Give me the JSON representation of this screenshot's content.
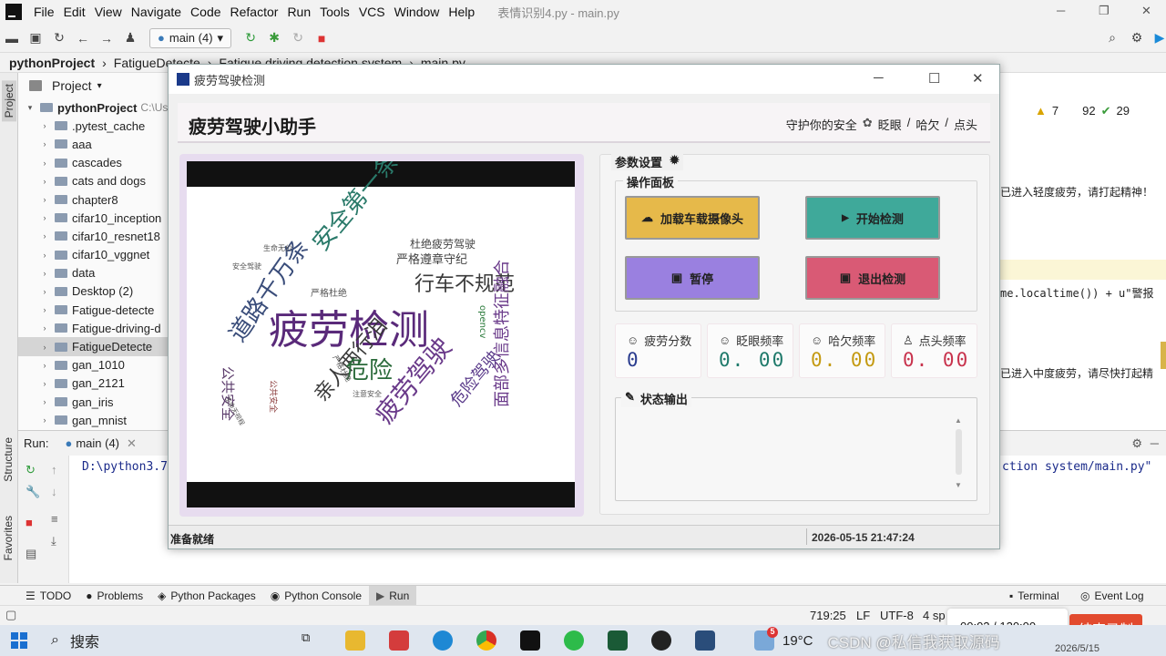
{
  "ide": {
    "menu": [
      "File",
      "Edit",
      "View",
      "Navigate",
      "Code",
      "Refactor",
      "Run",
      "Tools",
      "VCS",
      "Window",
      "Help"
    ],
    "window_title": "表情识别4.py - main.py",
    "run_config": "main (4)",
    "breadcrumb": [
      "pythonProject",
      "FatigueDetecte",
      "Fatigue driving detection system",
      "main.py"
    ],
    "project_panel": {
      "title": "Project",
      "root": "pythonProject",
      "root_path": "C:\\Us",
      "items": [
        ".pytest_cache",
        "aaa",
        "cascades",
        "cats and dogs",
        "chapter8",
        "cifar10_inception",
        "cifar10_resnet18",
        "cifar10_vggnet",
        "data",
        "Desktop (2)",
        "Fatigue-detecte",
        "Fatigue-driving-d",
        "FatigueDetecte",
        "gan_1010",
        "gan_2121",
        "gan_iris",
        "gan_mnist"
      ],
      "selected": "FatigueDetecte"
    },
    "inspections": {
      "warnings": "7",
      "weak": "92",
      "ok": "29"
    },
    "editor_lines": [
      "已进入轻度疲劳，请打起精神！",
      "me.localtime()) + u\"警报",
      "已进入中度疲劳，请尽快打起精"
    ],
    "run_tab": {
      "label": "Run:",
      "config": "main (4)",
      "line_left": "D:\\python3.7",
      "line_right": "ction system/main.py\""
    },
    "side_tabs": {
      "project": "Project",
      "structure": "Structure",
      "favorites": "Favorites"
    },
    "bottom_tabs": [
      "TODO",
      "Problems",
      "Python Packages",
      "Python Console",
      "Run",
      "Terminal",
      "Event Log"
    ],
    "status": {
      "position": "719:25",
      "line_sep": "LF",
      "encoding": "UTF-8",
      "indent": "4 sp"
    },
    "recorder": {
      "time": "00:02 / 120:00",
      "button": "结束录制"
    }
  },
  "taskbar": {
    "search_label": "搜索",
    "weather": "19°C",
    "weather_badge": "5",
    "watermark": "CSDN @私信我获取源码",
    "date": "2026/5/15"
  },
  "app": {
    "window_title": "疲劳驾驶检测",
    "heading": "疲劳驾驶小助手",
    "slogan": {
      "lead": "守护你的安全",
      "items": [
        "眨眼",
        "哈欠",
        "点头"
      ],
      "sep": "/"
    },
    "params_title": "参数设置",
    "ops_title": "操作面板",
    "buttons": {
      "load_camera": "加载车载摄像头",
      "start": "开始检测",
      "pause": "暂停",
      "exit": "退出检测"
    },
    "stats": [
      {
        "label": "疲劳分数",
        "value": "0",
        "color": "#2b3d8f"
      },
      {
        "label": "眨眼频率",
        "value": "0. 00",
        "color": "#1f7a6b"
      },
      {
        "label": "哈欠频率",
        "value": "0. 00",
        "color": "#c49a12"
      },
      {
        "label": "点头频率",
        "value": "0. 00",
        "color": "#c8334d"
      }
    ],
    "status_title": "状态输出",
    "footer_status": "准备就绪",
    "footer_time": "2026-05-15 21:47:24",
    "wordcloud": [
      "疲劳检测",
      "道路千万条",
      "安全第一条",
      "行车不规范",
      "亲人两行泪",
      "疲劳驾驶",
      "危险",
      "面部多信息特征融合",
      "危险驾驶",
      "杜绝疲劳驾驶",
      "严格遵章守纪",
      "公共安全",
      "严格杜绝",
      "注意安全",
      "opencv",
      "生命无价",
      "安全驾驶",
      "公共安全",
      "严格杜绝",
      "生命无视程"
    ]
  }
}
